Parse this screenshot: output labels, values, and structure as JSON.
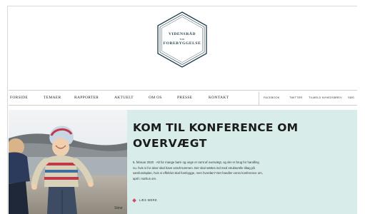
{
  "logo": {
    "line1": "VIDENSRÅD",
    "line2": "FOR",
    "line3": "FOREBYGGELSE",
    "colors": {
      "outline": "#1d3b47"
    }
  },
  "nav": {
    "items": [
      {
        "label": "FORSIDE"
      },
      {
        "label": "TEMAER"
      },
      {
        "label": "RAPPORTER"
      },
      {
        "label": "AKTUELT"
      },
      {
        "label": "OM OS"
      },
      {
        "label": "PRESSE"
      },
      {
        "label": "KONTAKT"
      }
    ],
    "social": [
      {
        "label": "FACEBOOK"
      },
      {
        "label": "TWITTER"
      },
      {
        "label": "TILMELD NYHEDSBREV"
      },
      {
        "label": "SØG"
      }
    ]
  },
  "hero": {
    "title_line1": "KOM TIL KONFERENCE OM",
    "title_line2": "OVERVÆGT",
    "text": "5. februar 2020 · Alt for mange børn og unge er ramt af overvægt, og der er brug for handling nu. hvis vi for alvor skal have vendt tummen. Der skal sættes ind med strukturelle tiltag på samfundsplan, hvis vi effektivt skal forebygge, men hvordan? Det handler vores konference om, april i Aarhus om.",
    "read_more": "LÆS MERE",
    "photo_caption": "Stine",
    "colors": {
      "panel": "#d8ecea",
      "accent": "#d04a66"
    }
  }
}
